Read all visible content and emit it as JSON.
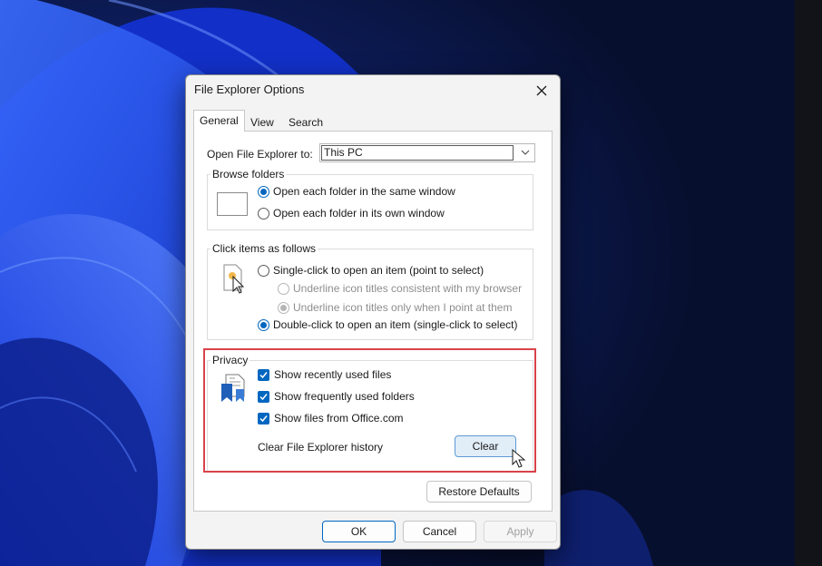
{
  "dialog": {
    "title": "File Explorer Options",
    "close_icon": "close-icon"
  },
  "tabs": [
    {
      "label": "General",
      "active": true
    },
    {
      "label": "View",
      "active": false
    },
    {
      "label": "Search",
      "active": false
    }
  ],
  "open_to": {
    "label": "Open File Explorer to:",
    "value": "This PC"
  },
  "browse_folders": {
    "legend": "Browse folders",
    "options": [
      {
        "label": "Open each folder in the same window",
        "checked": true
      },
      {
        "label": "Open each folder in its own window",
        "checked": false
      }
    ]
  },
  "click_items": {
    "legend": "Click items as follows",
    "single_click": "Single-click to open an item (point to select)",
    "sub_options": [
      {
        "label": "Underline icon titles consistent with my browser",
        "checked": false
      },
      {
        "label": "Underline icon titles only when I point at them",
        "checked": true
      }
    ],
    "double_click": "Double-click to open an item (single-click to select)"
  },
  "privacy": {
    "legend": "Privacy",
    "checks": [
      {
        "label": "Show recently used files",
        "checked": true
      },
      {
        "label": "Show frequently used folders",
        "checked": true
      },
      {
        "label": "Show files from Office.com",
        "checked": true
      }
    ],
    "clear_history_label": "Clear File Explorer history",
    "clear_button": "Clear"
  },
  "buttons": {
    "restore_defaults": "Restore Defaults",
    "ok": "OK",
    "cancel": "Cancel",
    "apply": "Apply"
  },
  "colors": {
    "accent": "#0067c0",
    "highlight": "#d9434a"
  }
}
